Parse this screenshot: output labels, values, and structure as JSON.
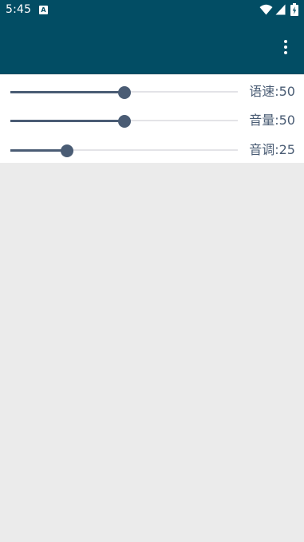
{
  "status_bar": {
    "time": "5:45",
    "notification_icon": "A",
    "icons": [
      "wifi-icon",
      "cell-signal-icon",
      "battery-charging-icon"
    ]
  },
  "app_bar": {
    "color": "#024d64",
    "menu_icon": "more-vert-icon"
  },
  "sliders": [
    {
      "id": "speed",
      "label": "语速:50",
      "value": 50,
      "max": 100
    },
    {
      "id": "volume",
      "label": "音量:50",
      "value": 50,
      "max": 100
    },
    {
      "id": "pitch",
      "label": "音调:25",
      "value": 25,
      "max": 100
    }
  ],
  "colors": {
    "accent": "#4a5c74",
    "track": "#e3e3e7",
    "background": "#ebebeb"
  }
}
